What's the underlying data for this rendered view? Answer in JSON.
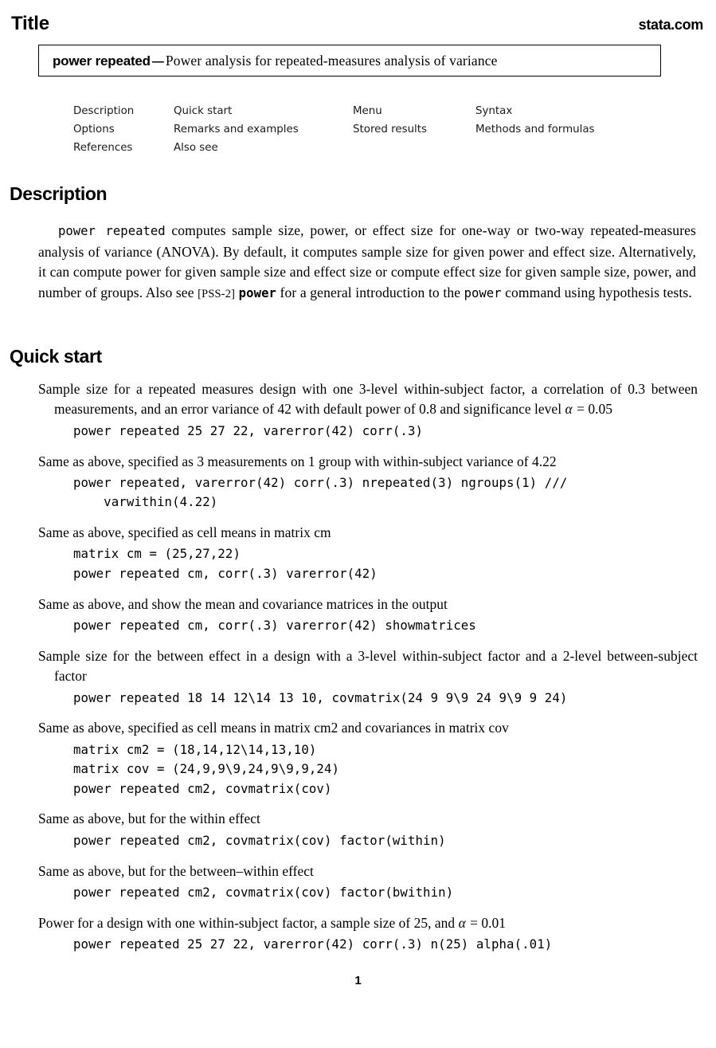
{
  "header": {
    "title": "Title",
    "site": "stata.com"
  },
  "title_box": {
    "command": "power repeated",
    "dash": "—",
    "description": "Power analysis for repeated-measures analysis of variance"
  },
  "toc": {
    "rows": [
      [
        "Description",
        "Quick start",
        "Menu",
        "Syntax"
      ],
      [
        "Options",
        "Remarks and examples",
        "Stored results",
        "Methods and formulas"
      ],
      [
        "References",
        "Also see",
        "",
        ""
      ]
    ]
  },
  "sections": {
    "description": {
      "heading": "Description",
      "body_part1": "power repeated",
      "body_part2": " computes sample size, power, or effect size for one-way or two-way repeated-measures analysis of variance (ANOVA). By default, it computes sample size for given power and effect size. Alternatively, it can compute power for given sample size and effect size or compute effect size for given sample size, power, and number of groups. Also see ",
      "body_ref": "[PSS-2]",
      "body_ref_cmd": "power",
      "body_part3": " for a general introduction to the ",
      "body_cmd2": "power",
      "body_part4": " command using hypothesis tests."
    },
    "quick_start": {
      "heading": "Quick start",
      "items": [
        {
          "text_a": "Sample size for a repeated measures design with one 3-level within-subject factor, a correlation of 0.3 between measurements, and an error variance of 42 with default power of 0.8 and significance level ",
          "math_var": "α",
          "math_rest": " = 0.05",
          "text_b": "",
          "code": "power repeated 25 27 22, varerror(42) corr(.3)"
        },
        {
          "text_a": "Same as above, specified as 3 measurements on 1 group with within-subject variance of 4.22",
          "code": "power repeated, varerror(42) corr(.3) nrepeated(3) ngroups(1) ///\n    varwithin(4.22)"
        },
        {
          "text_a": "Same as above, specified as cell means in matrix cm",
          "code": "matrix cm = (25,27,22)\npower repeated cm, corr(.3) varerror(42)"
        },
        {
          "text_a": "Same as above, and show the mean and covariance matrices in the output",
          "code": "power repeated cm, corr(.3) varerror(42) showmatrices"
        },
        {
          "text_a": "Sample size for the between effect in a design with a 3-level within-subject factor and a 2-level between-subject factor",
          "code": "power repeated 18 14 12\\14 13 10, covmatrix(24 9 9\\9 24 9\\9 9 24)"
        },
        {
          "text_a": "Same as above, specified as cell means in matrix cm2 and covariances in matrix cov",
          "code": "matrix cm2 = (18,14,12\\14,13,10)\nmatrix cov = (24,9,9\\9,24,9\\9,9,24)\npower repeated cm2, covmatrix(cov)"
        },
        {
          "text_a": "Same as above, but for the within effect",
          "code": "power repeated cm2, covmatrix(cov) factor(within)"
        },
        {
          "text_a": "Same as above, but for the between–within effect",
          "code": "power repeated cm2, covmatrix(cov) factor(bwithin)"
        },
        {
          "text_a": "Power for a design with one within-subject factor, a sample size of 25, and ",
          "math_var": "α",
          "math_rest": " = 0.01",
          "code": "power repeated 25 27 22, varerror(42) corr(.3) n(25) alpha(.01)"
        }
      ]
    }
  },
  "footer": {
    "page_number": "1"
  }
}
